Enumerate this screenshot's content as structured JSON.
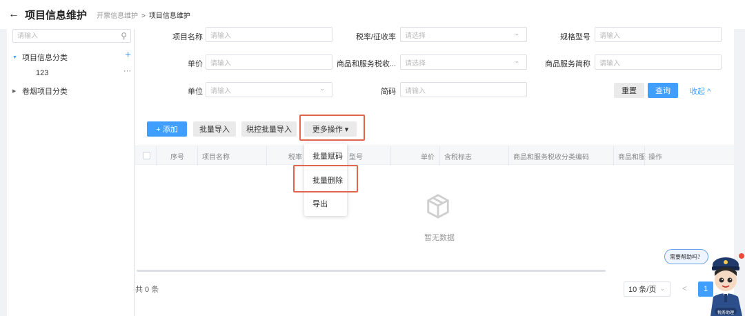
{
  "header": {
    "back_icon": "arrow-left-icon",
    "title": "项目信息维护",
    "breadcrumb": [
      "开票信息维护",
      "项目信息维护"
    ],
    "separator": ">"
  },
  "sidebar": {
    "search_placeholder": "请输入",
    "tree": [
      {
        "label": "项目信息分类",
        "expanded": true,
        "action": "+",
        "children": [
          {
            "label": "123",
            "action": "···"
          }
        ]
      },
      {
        "label": "卷烟项目分类",
        "expanded": false
      }
    ]
  },
  "filters": {
    "row1": [
      {
        "label": "项目名称",
        "placeholder": "请输入"
      },
      {
        "label": "税率/征收率",
        "placeholder": "请选择"
      },
      {
        "label": "规格型号",
        "placeholder": "请输入"
      }
    ],
    "row2": [
      {
        "label": "单价",
        "placeholder": "请输入"
      },
      {
        "label": "商品和服务税收...",
        "placeholder": "请选择"
      },
      {
        "label": "商品服务简称",
        "placeholder": "请输入"
      }
    ],
    "row3": [
      {
        "label": "单位",
        "placeholder": "请输入"
      },
      {
        "label": "简码",
        "placeholder": "请输入"
      }
    ],
    "reset_label": "重置",
    "query_label": "查询",
    "collapse_label": "收起",
    "collapse_icon": "^"
  },
  "toolbar": {
    "add_label": "+ 添加",
    "batch_import_label": "批量导入",
    "tax_batch_import_label": "税控批量导入",
    "more_label": "更多操作",
    "more_icon": "▾"
  },
  "table": {
    "columns": [
      "序号",
      "项目名称",
      "税率",
      "型号",
      "单价",
      "含税标志",
      "商品和服务税收分类编码",
      "商品和服",
      "操作"
    ],
    "empty_text": "暂无数据"
  },
  "dropdown": {
    "items": [
      "批量赋码",
      "批量删除",
      "导出"
    ]
  },
  "pagination": {
    "total": "共 0 条",
    "page_size": "10 条/页",
    "prev_icon": "<",
    "current_page": "1"
  },
  "help": {
    "bubble_text": "需要帮助吗？",
    "mascot_caption": "税务助理"
  },
  "colors": {
    "primary": "#409eff",
    "highlight": "#e0654b"
  }
}
